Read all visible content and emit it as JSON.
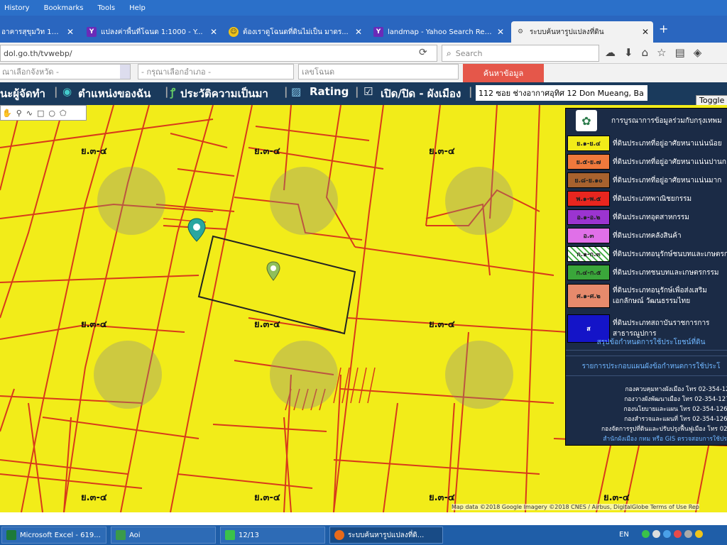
{
  "menubar": {
    "items": [
      "History",
      "Bookmarks",
      "Tools",
      "Help"
    ]
  },
  "tabs": [
    {
      "label": "อาคารสุขุมวิท 12 - ...",
      "icon": "generic-icon",
      "active": false
    },
    {
      "label": "แปลงค่าพื้นที่โฉนด 1:1000 - Y...",
      "icon": "yahoo-icon",
      "active": false
    },
    {
      "label": "ต้องเราดูโฉนดที่ดินไม่เป็น มาดร...",
      "icon": "smiley-icon",
      "active": false
    },
    {
      "label": "landmap - Yahoo Search Resu...",
      "icon": "yahoo-icon",
      "active": false
    },
    {
      "label": "ระบบค้นหารูปแปลงที่ดิน",
      "icon": "gear-icon",
      "active": true
    }
  ],
  "navbar": {
    "url": "dol.go.th/tvwebp/",
    "search_placeholder": "Search"
  },
  "site": {
    "province_select": "ณาเลือกจังหวัด -",
    "district_select": "- กรุณาเลือกอำเภอ -",
    "deed_input": "เลขโฉนด",
    "search_button": "ค้นหาข้อมูล"
  },
  "toolbar": {
    "items": [
      "นะผู้จัดทำ",
      "ตำแหน่งของฉัน",
      "ประวัติความเป็นมา",
      "Rating",
      "เปิด/ปิด - ผังเมือง"
    ],
    "address": "112 ซอย ช่างอากาศอุทิศ 12 Don Mueang, Ba",
    "toggle_label": "Toggle"
  },
  "map": {
    "zone_label": "ย.๓-๔",
    "credit": "Map data ©2018 Google Imagery ©2018 CNES / Airbus, DigitalGlobe   Terms of Use   Rep"
  },
  "legend": {
    "title": "การบูรณาการข้อมูลร่วมกับกรุงเทพม",
    "rows": [
      {
        "code": "ย.๑-ย.๔",
        "text": "ที่ดินประเภทที่อยู่อาศัยหนาแน่นน้อย",
        "color": "#f2ec19",
        "lines": 1
      },
      {
        "code": "ย.๕-ย.๗",
        "text": "ที่ดินประเภทที่อยู่อาศัยหนาแน่นปานก",
        "color": "#f0793c",
        "lines": 1
      },
      {
        "code": "ย.๘-ย.๑๐",
        "text": "ที่ดินประเภทที่อยู่อาศัยหนาแน่นมาก",
        "color": "#a8622e",
        "lines": 1
      },
      {
        "code": "พ.๑-พ.๕",
        "text": "ที่ดินประเภทพาณิชยกรรม",
        "color": "#e8261f",
        "lines": 1
      },
      {
        "code": "อ.๑-อ.๒",
        "text": "ที่ดินประเภทอุตสาหกรรม",
        "color": "#9b34d0",
        "lines": 1
      },
      {
        "code": "อ.๓",
        "text": "ที่ดินประเภทคลังสินค้า",
        "color": "#e070e8",
        "lines": 1
      },
      {
        "code": "ก.๑-ก.๓",
        "text": "ที่ดินประเภทอนุรักษ์ชนบทและเกษตรก",
        "color": "#ffffff",
        "lines": 1
      },
      {
        "code": "ก.๔-ก.๕",
        "text": "ที่ดินประเภทชนบทและเกษตรกรรม",
        "color": "#3aa63a",
        "lines": 1
      },
      {
        "code": "ศ.๑-ศ.๒",
        "text": "ที่ดินประเภทอนุรักษ์เพื่อส่งเสริมเอกลักษณ์ วัฒนธรรมไทย",
        "color": "#e68a6c",
        "lines": 2
      },
      {
        "code": "ส",
        "text": "ที่ดินประเภทสถาบันราชการการสาธารณูปการ",
        "color": "#1414c8",
        "lines": 3
      }
    ],
    "link1": "สรุปข้อกำหนดการใช้ประโยชน์ที่ดิน",
    "link2": "รายการประกอบแผนผังข้อกำหนดการใช้ประโ",
    "contacts": [
      "กองควบคุมทางผังเมือง โทร 02-354-128",
      "กองวางผังพัฒนาเมือง โทร 02-354-1274",
      "กองนโยบายและแผน โทร 02-354-1262-",
      "กองสำรวจและแผนที่ โทร 02-354-1268-",
      "กองจัดการรูปที่ดินและปรับปรุงฟื้นฟูเมือง โทร 02-3"
    ],
    "footer": "สำนักผังเมือง กทม  หรือ  GIS ตรวจสอบการใช้ประโ"
  },
  "taskbar": {
    "items": [
      "Microsoft Excel - 619...",
      "Aoi",
      "12/13",
      "ระบบค้นหารูปแปลงที่ดิ..."
    ],
    "lang": "EN"
  }
}
